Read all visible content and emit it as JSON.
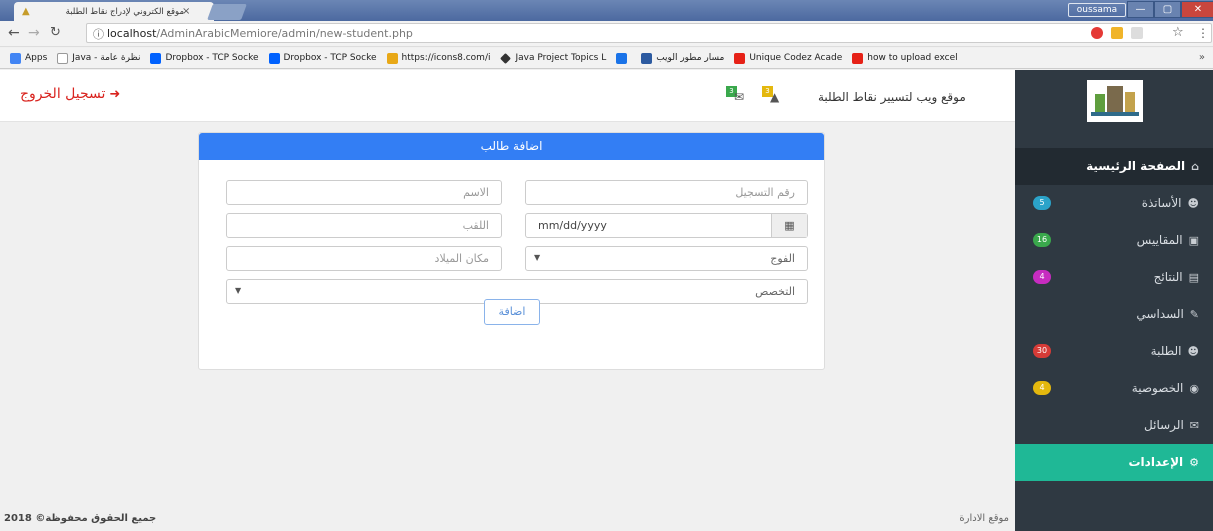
{
  "browser": {
    "tab_title": "موقع الكتروني لإدراج نقاط الطلبة",
    "tab_close": "×",
    "profile": "oussama",
    "url_host": "localhost",
    "url_path": "/AdminArabicMemiore/admin/new-student.php",
    "bookmarks": [
      {
        "label": "Apps",
        "color": "#4285f4"
      },
      {
        "label": "Java - نظرة عامة",
        "color": "#9e9e9e"
      },
      {
        "label": "Dropbox - TCP Socke",
        "color": "#0061fe"
      },
      {
        "label": "Dropbox - TCP Socke",
        "color": "#0061fe"
      },
      {
        "label": "https://icons8.com/i",
        "color": "#e8a817"
      },
      {
        "label": "Java Project Topics L",
        "color": "#333333"
      },
      {
        "label": "",
        "color": "#1a73e8"
      },
      {
        "label": "مسار مطور الويب",
        "color": "#2c5aa0"
      },
      {
        "label": "Unique Codez Acade",
        "color": "#e62117"
      },
      {
        "label": "how to upload excel",
        "color": "#e62117"
      }
    ],
    "bookmarks_more": "»"
  },
  "header": {
    "logout_label": "تسجيل الخروج",
    "site_title": "موقع ويب لتسيير نقاط الطلبة",
    "messages_count": "3",
    "notifications_count": "3"
  },
  "form": {
    "title": "اضافة طالب",
    "reg_number_placeholder": "رقم التسجيل",
    "name_placeholder": "الاسم",
    "date_value": "mm/dd/yyyy",
    "surname_placeholder": "اللقب",
    "group_placeholder": "الفوج",
    "birthplace_placeholder": "مكان الميلاد",
    "specialty_placeholder": "التخصص",
    "submit_label": "اضافة"
  },
  "sidebar": {
    "items": [
      {
        "label": "الصفحة الرئيسية",
        "icon": "home-icon",
        "badge": ""
      },
      {
        "label": "الأساتذة",
        "icon": "user-icon",
        "badge": "5",
        "badge_color": "#2ba3c9"
      },
      {
        "label": "المقاييس",
        "icon": "book-icon",
        "badge": "16",
        "badge_color": "#3aa84c"
      },
      {
        "label": "النتائج",
        "icon": "list-icon",
        "badge": "4",
        "badge_color": "#c72cc0"
      },
      {
        "label": "السداسي",
        "icon": "pencil-icon",
        "badge": ""
      },
      {
        "label": "الطلبة",
        "icon": "user-icon",
        "badge": "30",
        "badge_color": "#d63b37"
      },
      {
        "label": "الخصوصية",
        "icon": "lock-icon",
        "badge": "4",
        "badge_color": "#e4b80e"
      },
      {
        "label": "الرسائل",
        "icon": "envelope-icon",
        "badge": ""
      },
      {
        "label": "الإعدادات",
        "icon": "gear-icon",
        "badge": ""
      }
    ]
  },
  "footer": {
    "copyright": "جميع الحقوق محفوظة© 2018",
    "admin_site": "موقع الادارة"
  }
}
